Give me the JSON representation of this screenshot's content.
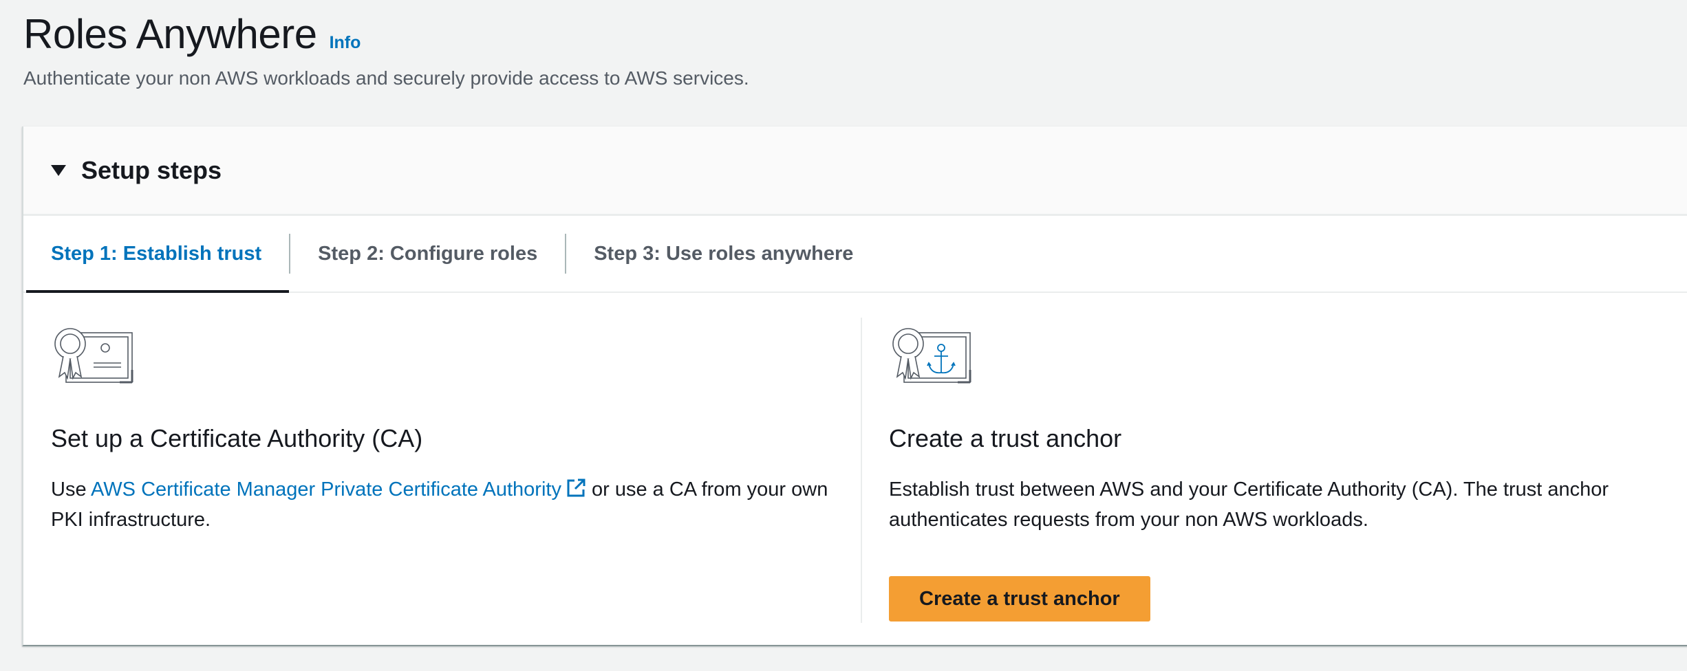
{
  "header": {
    "title": "Roles Anywhere",
    "info_label": "Info",
    "subtitle": "Authenticate your non AWS workloads and securely provide access to AWS services."
  },
  "setup": {
    "title": "Setup steps",
    "tabs": [
      {
        "label": "Step 1: Establish trust",
        "active": true
      },
      {
        "label": "Step 2: Configure roles",
        "active": false
      },
      {
        "label": "Step 3: Use roles anywhere",
        "active": false
      }
    ],
    "left": {
      "icon": "certificate-icon",
      "heading": "Set up a Certificate Authority (CA)",
      "text_before": "Use ",
      "link_label": "AWS Certificate Manager Private Certificate Authority",
      "link_icon": "external-link-icon",
      "text_after": " or use a CA from your own PKI infrastructure."
    },
    "right": {
      "icon": "certificate-anchor-icon",
      "heading": "Create a trust anchor",
      "text": "Establish trust between AWS and your Certificate Authority (CA). The trust anchor authenticates requests from your non AWS workloads.",
      "button_label": "Create a trust anchor"
    }
  },
  "colors": {
    "link": "#0073bb",
    "primary_button": "#f49e33",
    "text": "#16191f",
    "muted": "#545b64"
  }
}
